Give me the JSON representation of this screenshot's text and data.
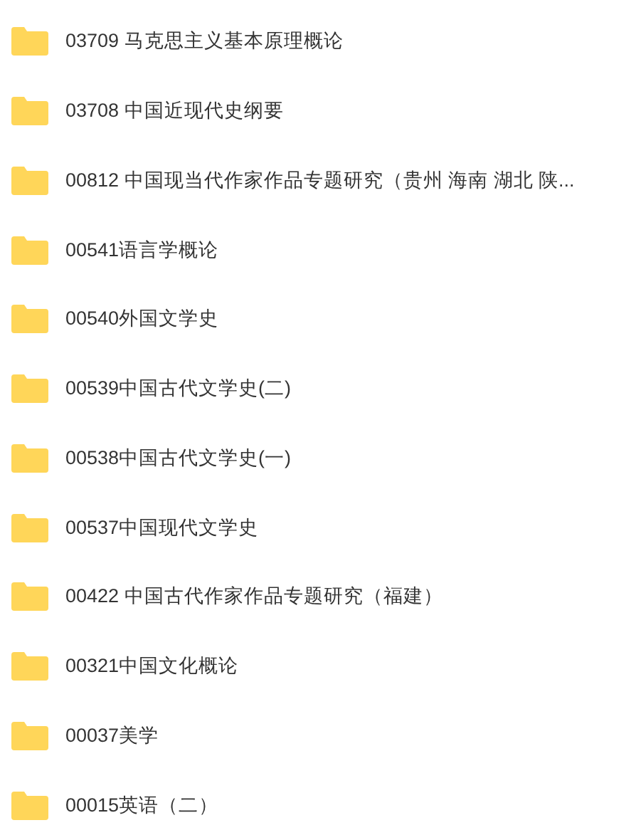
{
  "folders": [
    {
      "name": "03709 马克思主义基本原理概论"
    },
    {
      "name": "03708 中国近现代史纲要"
    },
    {
      "name": "00812 中国现当代作家作品专题研究（贵州 海南 湖北 陕..."
    },
    {
      "name": "00541语言学概论"
    },
    {
      "name": "00540外国文学史"
    },
    {
      "name": "00539中国古代文学史(二)"
    },
    {
      "name": "00538中国古代文学史(一)"
    },
    {
      "name": "00537中国现代文学史"
    },
    {
      "name": "00422 中国古代作家作品专题研究（福建）"
    },
    {
      "name": "00321中国文化概论"
    },
    {
      "name": "00037美学"
    },
    {
      "name": "00015英语（二）"
    }
  ]
}
